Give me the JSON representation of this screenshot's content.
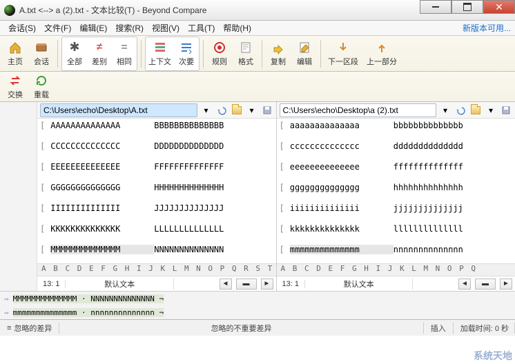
{
  "title": "A.txt <--> a (2).txt - 文本比较(T) - Beyond Compare",
  "menu": {
    "items": [
      "会话(S)",
      "文件(F)",
      "编辑(E)",
      "搜索(R)",
      "视图(V)",
      "工具(T)",
      "帮助(H)"
    ],
    "update": "新版本可用..."
  },
  "toolbar": {
    "home": "主页",
    "sess": "会话",
    "all": "全部",
    "diff": "差别",
    "same": "相同",
    "ctx": "上下文",
    "minor": "次要",
    "rules": "规则",
    "fmt": "格式",
    "copy": "复制",
    "edit": "编辑",
    "prev": "下一区段",
    "next": "上一部分",
    "swap": "交换",
    "reload": "重载"
  },
  "paths": {
    "left": "C:\\Users\\echo\\Desktop\\A.txt",
    "right": "C:\\Users\\echo\\Desktop\\a (2).txt"
  },
  "leftLines": [
    {
      "a": "AAAAAAAAAAAAAA",
      "b": "BBBBBBBBBBBBBB"
    },
    {
      "a": "CCCCCCCCCCCCCC",
      "b": "DDDDDDDDDDDDDD"
    },
    {
      "a": "EEEEEEEEEEEEEE",
      "b": "FFFFFFFFFFFFFF"
    },
    {
      "a": "GGGGGGGGGGGGGG",
      "b": "HHHHHHHHHHHHHH"
    },
    {
      "a": "IIIIIIIIIIIIII",
      "b": "JJJJJJJJJJJJJJ"
    },
    {
      "a": "KKKKKKKKKKKKKK",
      "b": "LLLLLLLLLLLLLL"
    },
    {
      "a": "MMMMMMMMMMMMMM",
      "b": "NNNNNNNNNNNNNN",
      "hl": true
    }
  ],
  "rightLines": [
    {
      "a": "aaaaaaaaaaaaaa",
      "b": "bbbbbbbbbbbbbb"
    },
    {
      "a": "cccccccccccccc",
      "b": "dddddddddddddd"
    },
    {
      "a": "eeeeeeeeeeeeee",
      "b": "ffffffffffffff"
    },
    {
      "a": "gggggggggggggg",
      "b": "hhhhhhhhhhhhhh"
    },
    {
      "a": "iiiiiiiiiiiiii",
      "b": "jjjjjjjjjjjjjj"
    },
    {
      "a": "kkkkkkkkkkkkkk",
      "b": "llllllllllllll"
    },
    {
      "a": "mmmmmmmmmmmmmm",
      "b": "nnnnnnnnnnnnnn",
      "hl": true
    }
  ],
  "ruler": "A B C D E F G H I J K L M N O P Q R S T U V",
  "ruler2": "A B C D E F G H I J K L M N O P Q",
  "pos": {
    "left": "13: 1",
    "right": "13: 1",
    "enc": "默认文本"
  },
  "diffStrip": {
    "a": "MMMMMMMMMMMMMM · NNNNNNNNNNNNNN ¬",
    "b": "mmmmmmmmmmmmmm · nnnnnnnnnnnnnn ¬"
  },
  "status": {
    "ignored": "忽略的差异",
    "nonimp": "忽略的不重要差异",
    "insert": "插入",
    "time": "加载时间: 0 秒"
  },
  "watermark": "系统天地"
}
